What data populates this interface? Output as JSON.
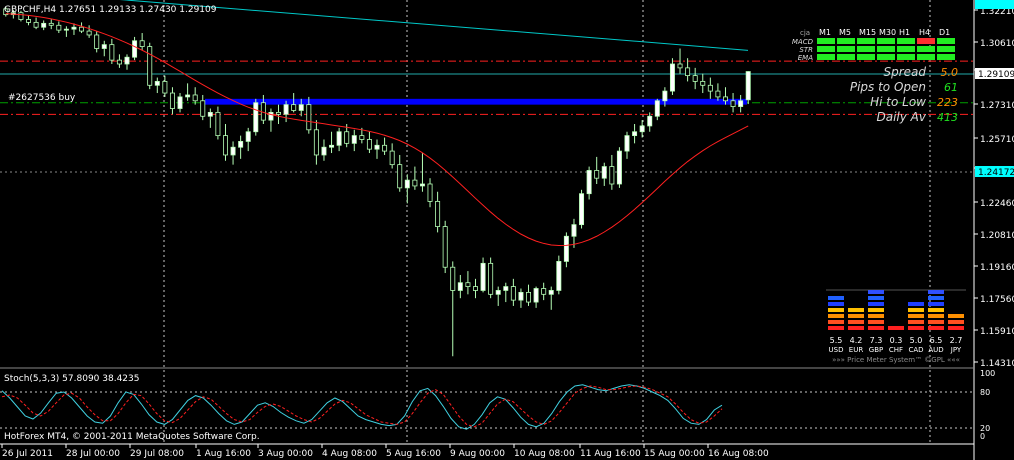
{
  "header": {
    "symbol_line": "GBPCHF,H4  1.27651 1.29133 1.27430 1.29109"
  },
  "trade_label": "#2627536 buy",
  "stoch_header": "Stoch(5,3,3) 57.8090 38.4235",
  "copyright": "HotForex MT4, © 2001-2011 MetaQuotes Software Corp.",
  "colors": {
    "background": "#000000",
    "bull_candle": "#ffffff",
    "bear_candle": "#000000",
    "candle_outline": "#b6ffb6",
    "ma_line": "#ff0000",
    "trend_line": "#00c8c8",
    "zone": "#0000ff",
    "stoch_main": "#40d0e0",
    "stoch_signal": "#ff2020",
    "grid": "#c8c8c8",
    "price_tag_bg": "#00ffff"
  },
  "chart_data": {
    "type": "candlestick",
    "symbol": "GBPCHF",
    "timeframe": "H4",
    "title": "GBPCHF,H4",
    "ylim": [
      1.14,
      1.326
    ],
    "y_ticks": [
      "1.32210",
      "1.30610",
      "1.29109",
      "1.27310",
      "1.25710",
      "1.24172",
      "1.22460",
      "1.20810",
      "1.19160",
      "1.17560",
      "1.15910",
      "1.14310"
    ],
    "current_price": "1.29109",
    "marker_price": "1.24172",
    "x_labels": [
      "26 Jul 2011",
      "28 Jul 00:00",
      "29 Jul 08:00",
      "1 Aug 16:00",
      "3 Aug 00:00",
      "4 Aug 08:00",
      "5 Aug 16:00",
      "9 Aug 00:00",
      "10 Aug 08:00",
      "11 Aug 16:00",
      "15 Aug 00:00",
      "16 Aug 08:00"
    ],
    "candles": [
      [
        1.3235,
        1.3245,
        1.3195,
        1.3205
      ],
      [
        1.3205,
        1.323,
        1.3185,
        1.3215
      ],
      [
        1.3215,
        1.3225,
        1.317,
        1.318
      ],
      [
        1.318,
        1.32,
        1.315,
        1.3165
      ],
      [
        1.3165,
        1.319,
        1.313,
        1.314
      ],
      [
        1.314,
        1.3175,
        1.3125,
        1.316
      ],
      [
        1.316,
        1.318,
        1.313,
        1.315
      ],
      [
        1.315,
        1.317,
        1.311,
        1.3125
      ],
      [
        1.3125,
        1.3145,
        1.309,
        1.313
      ],
      [
        1.313,
        1.316,
        1.31,
        1.314
      ],
      [
        1.314,
        1.3165,
        1.311,
        1.312
      ],
      [
        1.312,
        1.315,
        1.3085,
        1.31
      ],
      [
        1.31,
        1.312,
        1.301,
        1.303
      ],
      [
        1.303,
        1.307,
        1.299,
        1.305
      ],
      [
        1.305,
        1.308,
        1.295,
        1.297
      ],
      [
        1.297,
        1.3,
        1.293,
        1.295
      ],
      [
        1.295,
        1.3,
        1.292,
        1.2985
      ],
      [
        1.2985,
        1.309,
        1.297,
        1.307
      ],
      [
        1.307,
        1.311,
        1.302,
        1.304
      ],
      [
        1.304,
        1.306,
        1.282,
        1.284
      ],
      [
        1.284,
        1.288,
        1.28,
        1.286
      ],
      [
        1.286,
        1.289,
        1.278,
        1.28
      ],
      [
        1.28,
        1.283,
        1.269,
        1.272
      ],
      [
        1.272,
        1.28,
        1.27,
        1.278
      ],
      [
        1.278,
        1.285,
        1.276,
        1.279
      ],
      [
        1.279,
        1.283,
        1.274,
        1.276
      ],
      [
        1.276,
        1.279,
        1.266,
        1.268
      ],
      [
        1.268,
        1.272,
        1.262,
        1.27
      ],
      [
        1.27,
        1.273,
        1.256,
        1.258
      ],
      [
        1.258,
        1.264,
        1.245,
        1.248
      ],
      [
        1.248,
        1.255,
        1.243,
        1.252
      ],
      [
        1.252,
        1.258,
        1.246,
        1.255
      ],
      [
        1.255,
        1.262,
        1.25,
        1.26
      ],
      [
        1.26,
        1.277,
        1.258,
        1.275
      ],
      [
        1.275,
        1.279,
        1.264,
        1.266
      ],
      [
        1.266,
        1.272,
        1.26,
        1.27
      ],
      [
        1.27,
        1.274,
        1.264,
        1.269
      ],
      [
        1.269,
        1.276,
        1.265,
        1.274
      ],
      [
        1.274,
        1.28,
        1.27,
        1.271
      ],
      [
        1.271,
        1.277,
        1.268,
        1.274
      ],
      [
        1.274,
        1.278,
        1.259,
        1.261
      ],
      [
        1.261,
        1.266,
        1.243,
        1.248
      ],
      [
        1.248,
        1.256,
        1.245,
        1.252
      ],
      [
        1.252,
        1.26,
        1.249,
        1.253
      ],
      [
        1.253,
        1.262,
        1.25,
        1.26
      ],
      [
        1.26,
        1.264,
        1.252,
        1.254
      ],
      [
        1.254,
        1.261,
        1.25,
        1.258
      ],
      [
        1.258,
        1.262,
        1.254,
        1.256
      ],
      [
        1.256,
        1.26,
        1.249,
        1.251
      ],
      [
        1.251,
        1.256,
        1.246,
        1.253
      ],
      [
        1.253,
        1.257,
        1.248,
        1.25
      ],
      [
        1.25,
        1.254,
        1.241,
        1.243
      ],
      [
        1.243,
        1.248,
        1.229,
        1.231
      ],
      [
        1.231,
        1.238,
        1.223,
        1.235
      ],
      [
        1.235,
        1.242,
        1.23,
        1.232
      ],
      [
        1.232,
        1.249,
        1.229,
        1.233
      ],
      [
        1.233,
        1.236,
        1.221,
        1.224
      ],
      [
        1.224,
        1.229,
        1.208,
        1.211
      ],
      [
        1.211,
        1.214,
        1.187,
        1.19
      ],
      [
        1.19,
        1.193,
        1.144,
        1.178
      ],
      [
        1.178,
        1.186,
        1.174,
        1.182
      ],
      [
        1.182,
        1.188,
        1.176,
        1.18
      ],
      [
        1.18,
        1.184,
        1.174,
        1.178
      ],
      [
        1.178,
        1.195,
        1.177,
        1.192
      ],
      [
        1.192,
        1.195,
        1.174,
        1.176
      ],
      [
        1.176,
        1.18,
        1.17,
        1.178
      ],
      [
        1.178,
        1.182,
        1.172,
        1.18
      ],
      [
        1.18,
        1.184,
        1.17,
        1.173
      ],
      [
        1.173,
        1.179,
        1.169,
        1.177
      ],
      [
        1.177,
        1.181,
        1.17,
        1.172
      ],
      [
        1.172,
        1.18,
        1.169,
        1.179
      ],
      [
        1.179,
        1.182,
        1.173,
        1.176
      ],
      [
        1.176,
        1.18,
        1.168,
        1.178
      ],
      [
        1.178,
        1.196,
        1.176,
        1.193
      ],
      [
        1.193,
        1.208,
        1.19,
        1.206
      ],
      [
        1.206,
        1.215,
        1.2,
        1.212
      ],
      [
        1.212,
        1.23,
        1.21,
        1.228
      ],
      [
        1.228,
        1.242,
        1.225,
        1.24
      ],
      [
        1.24,
        1.247,
        1.233,
        1.236
      ],
      [
        1.236,
        1.244,
        1.232,
        1.242
      ],
      [
        1.242,
        1.248,
        1.23,
        1.233
      ],
      [
        1.233,
        1.252,
        1.231,
        1.25
      ],
      [
        1.25,
        1.26,
        1.246,
        1.258
      ],
      [
        1.258,
        1.264,
        1.254,
        1.26
      ],
      [
        1.26,
        1.266,
        1.257,
        1.263
      ],
      [
        1.263,
        1.27,
        1.26,
        1.268
      ],
      [
        1.268,
        1.277,
        1.266,
        1.276
      ],
      [
        1.276,
        1.283,
        1.273,
        1.281
      ],
      [
        1.281,
        1.298,
        1.279,
        1.295
      ],
      [
        1.295,
        1.303,
        1.29,
        1.293
      ],
      [
        1.293,
        1.298,
        1.286,
        1.289
      ],
      [
        1.289,
        1.293,
        1.282,
        1.286
      ],
      [
        1.286,
        1.29,
        1.28,
        1.284
      ],
      [
        1.284,
        1.288,
        1.277,
        1.281
      ],
      [
        1.281,
        1.285,
        1.276,
        1.278
      ],
      [
        1.278,
        1.283,
        1.274,
        1.276
      ],
      [
        1.276,
        1.28,
        1.27,
        1.273
      ],
      [
        1.273,
        1.279,
        1.27,
        1.276
      ],
      [
        1.2765,
        1.2913,
        1.2743,
        1.2911
      ]
    ],
    "ma": [
      1.321,
      1.3208,
      1.3205,
      1.3201,
      1.3196,
      1.319,
      1.3183,
      1.3175,
      1.3166,
      1.3156,
      1.3145,
      1.3133,
      1.312,
      1.3106,
      1.3091,
      1.3075,
      1.3058,
      1.304,
      1.3021,
      1.3001,
      1.298,
      1.2958,
      1.2935,
      1.2912,
      1.2889,
      1.2866,
      1.2843,
      1.2821,
      1.28,
      1.278,
      1.2761,
      1.2743,
      1.2727,
      1.2713,
      1.27,
      1.2689,
      1.268,
      1.2672,
      1.2665,
      1.2659,
      1.2653,
      1.2647,
      1.2641,
      1.2635,
      1.2629,
      1.2623,
      1.2617,
      1.261,
      1.2602,
      1.2593,
      1.2582,
      1.2569,
      1.2554,
      1.2536,
      1.2515,
      1.2491,
      1.2464,
      1.2434,
      1.2401,
      1.2366,
      1.233,
      1.2293,
      1.2256,
      1.222,
      1.2185,
      1.2152,
      1.2122,
      1.2095,
      1.2071,
      1.2051,
      1.2035,
      1.2023,
      1.2015,
      1.2012,
      1.2013,
      1.2018,
      1.2028,
      1.2042,
      1.206,
      1.2082,
      1.2107,
      1.2135,
      1.2166,
      1.2199,
      1.2234,
      1.227,
      1.2307,
      1.2344,
      1.238,
      1.2414,
      1.2446,
      1.2475,
      1.2502,
      1.2527,
      1.2549,
      1.257,
      1.259,
      1.261,
      1.263
    ],
    "ma_start_index": 0,
    "zone": {
      "from": 1.274,
      "to": 1.277
    },
    "hlines": [
      {
        "price": 1.2965,
        "color": "#ff2020",
        "style": "dash-dot"
      },
      {
        "price": 1.275,
        "color": "#00a000",
        "style": "dash-dot"
      },
      {
        "price": 1.269,
        "color": "#ff2020",
        "style": "dash-dot"
      }
    ],
    "trend_line": {
      "from_index": 9,
      "from_price": 1.323,
      "to_index": 98,
      "to_price": 1.3
    },
    "stoch_main": [
      82,
      70,
      55,
      40,
      35,
      45,
      62,
      78,
      80,
      70,
      55,
      40,
      30,
      28,
      40,
      62,
      80,
      76,
      60,
      42,
      30,
      26,
      34,
      50,
      66,
      74,
      70,
      58,
      44,
      32,
      26,
      30,
      44,
      58,
      62,
      56,
      46,
      38,
      32,
      28,
      34,
      48,
      62,
      70,
      64,
      52,
      40,
      34,
      30,
      26,
      24,
      26,
      40,
      64,
      82,
      86,
      74,
      56,
      36,
      22,
      18,
      26,
      42,
      62,
      72,
      68,
      54,
      38,
      26,
      22,
      28,
      44,
      64,
      80,
      90,
      92,
      88,
      84,
      82,
      86,
      90,
      92,
      90,
      86,
      80,
      74,
      66,
      52,
      36,
      28,
      26,
      34,
      50,
      58
    ],
    "stoch_signal": [
      72,
      75,
      70,
      58,
      45,
      40,
      48,
      62,
      75,
      78,
      70,
      55,
      42,
      32,
      32,
      44,
      62,
      76,
      74,
      60,
      44,
      32,
      29,
      36,
      50,
      64,
      72,
      68,
      56,
      44,
      34,
      30,
      34,
      46,
      56,
      60,
      56,
      48,
      40,
      34,
      30,
      36,
      48,
      60,
      66,
      62,
      52,
      42,
      36,
      30,
      28,
      26,
      30,
      44,
      62,
      78,
      84,
      76,
      58,
      40,
      26,
      22,
      28,
      44,
      60,
      68,
      64,
      52,
      40,
      30,
      26,
      32,
      46,
      62,
      78,
      86,
      90,
      88,
      84,
      84,
      86,
      89,
      90,
      88,
      84,
      78,
      72,
      60,
      46,
      34,
      28,
      30,
      40,
      52
    ],
    "stoch_levels": [
      "100",
      "80",
      "20",
      "0"
    ],
    "price_meter": {
      "currencies": [
        "USD",
        "EUR",
        "GBP",
        "CHF",
        "CAD",
        "AUD",
        "JPY"
      ],
      "values": [
        "5.5",
        "4.2",
        "7.3",
        "0.3",
        "5.0",
        "6.5",
        "2.7"
      ],
      "caption": "»»» Price Meter System™ ©GPL «««"
    },
    "signal_table": {
      "header_label": "cja",
      "timeframes": [
        "M1",
        "M5",
        "M15",
        "M30",
        "H1",
        "H4",
        "D1"
      ],
      "rows": [
        "MACD",
        "STR",
        "EMA"
      ]
    },
    "info_panel": [
      {
        "label": "Spread",
        "value": "5.0",
        "color": "#ff8c00"
      },
      {
        "label": "Pips to Open",
        "value": "61",
        "color": "#20e020"
      },
      {
        "label": "Hi to Low",
        "value": "223",
        "color": "#ff8c00"
      },
      {
        "label": "Daily Av",
        "value": "413",
        "color": "#20e020"
      }
    ]
  }
}
